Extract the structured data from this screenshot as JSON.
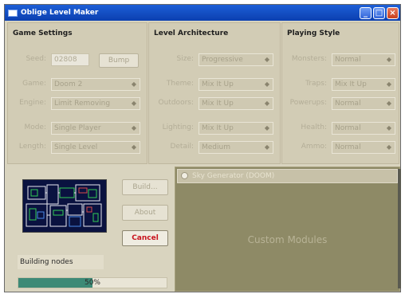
{
  "window": {
    "title": "Oblige Level Maker"
  },
  "game_settings": {
    "heading": "Game Settings",
    "seed_label": "Seed:",
    "seed_value": "02808",
    "bump_label": "Bump",
    "game_label": "Game:",
    "game_value": "Doom 2",
    "engine_label": "Engine:",
    "engine_value": "Limit Removing",
    "mode_label": "Mode:",
    "mode_value": "Single Player",
    "length_label": "Length:",
    "length_value": "Single Level"
  },
  "level_architecture": {
    "heading": "Level Architecture",
    "size_label": "Size:",
    "size_value": "Progressive",
    "theme_label": "Theme:",
    "theme_value": "Mix It Up",
    "outdoors_label": "Outdoors:",
    "outdoors_value": "Mix It Up",
    "lighting_label": "Lighting:",
    "lighting_value": "Mix It Up",
    "detail_label": "Detail:",
    "detail_value": "Medium"
  },
  "playing_style": {
    "heading": "Playing Style",
    "monsters_label": "Monsters:",
    "monsters_value": "Normal",
    "traps_label": "Traps:",
    "traps_value": "Mix It Up",
    "powerups_label": "Powerups:",
    "powerups_value": "Normal",
    "health_label": "Health:",
    "health_value": "Normal",
    "ammo_label": "Ammo:",
    "ammo_value": "Normal"
  },
  "actions": {
    "build_label": "Build...",
    "about_label": "About",
    "cancel_label": "Cancel"
  },
  "status": {
    "text": "Building nodes",
    "progress_percent": 50,
    "progress_text": "50%"
  },
  "modules": {
    "generator_label": "Sky Generator (DOOM)",
    "placeholder": "Custom Modules"
  },
  "colors": {
    "title_bar": "#1d5fd6",
    "progress_fill": "#3d8a76",
    "cancel_text": "#c8141e",
    "modules_bg": "#8e8a66"
  }
}
